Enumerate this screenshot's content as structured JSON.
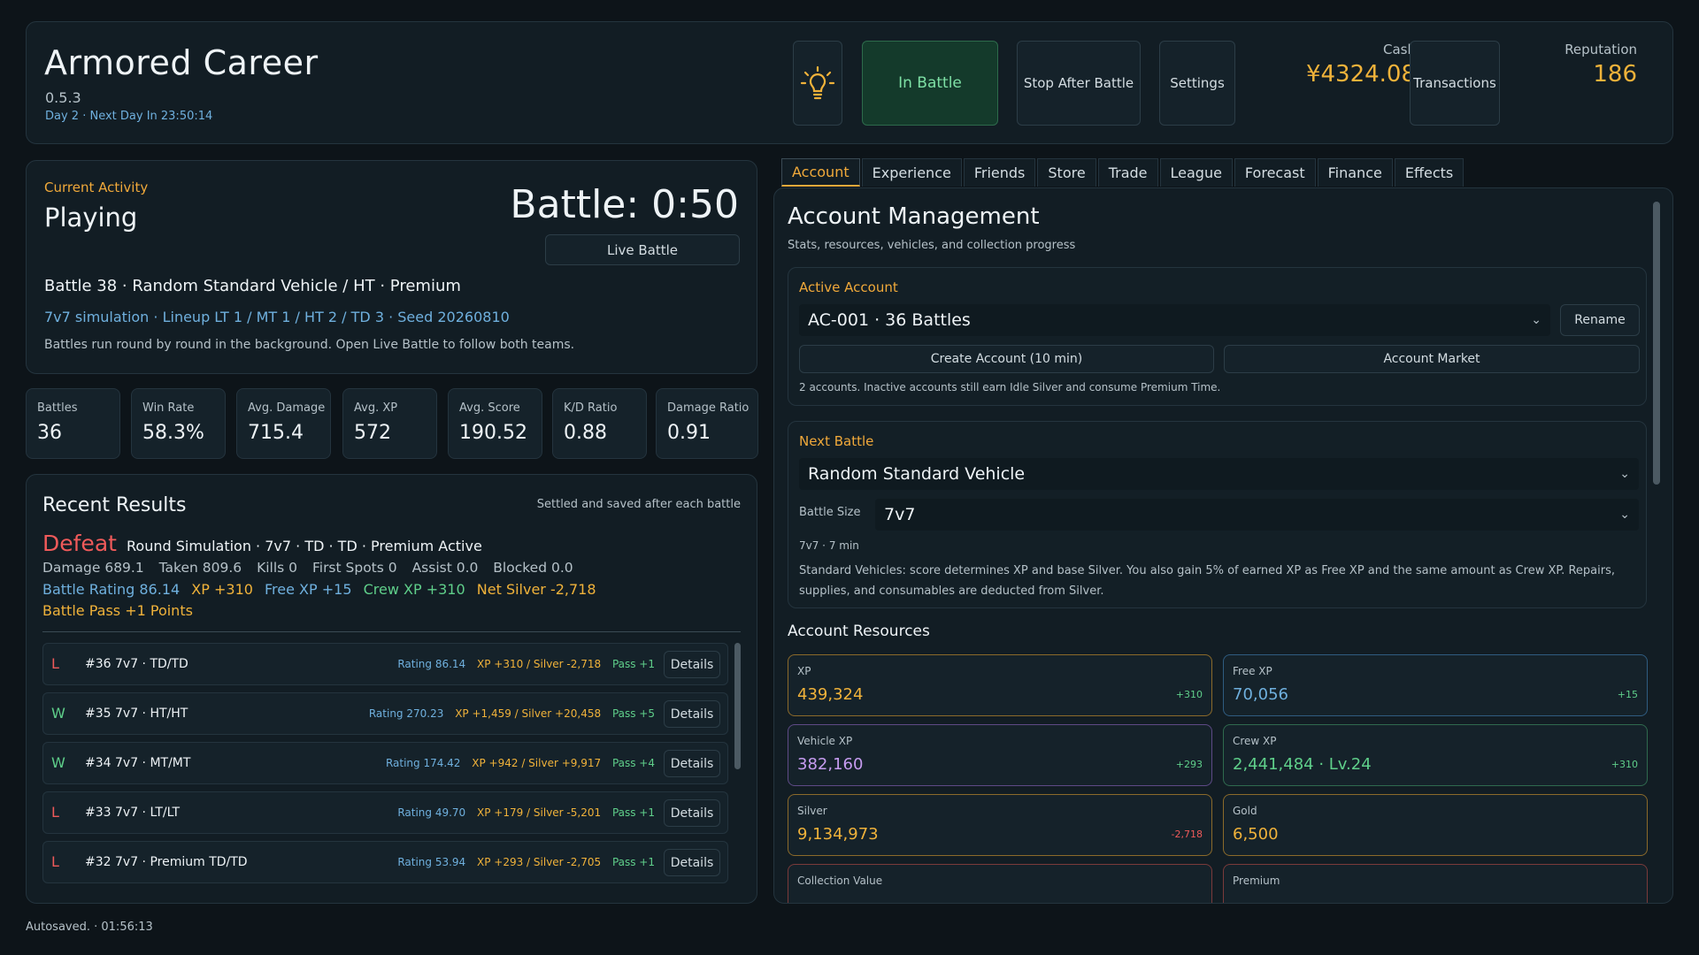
{
  "header": {
    "title": "Armored Career",
    "version": "0.5.3",
    "day_text": "Day 2 · Next Day In 23:50:14",
    "in_battle_label": "In Battle",
    "stop_label": "Stop After Battle",
    "settings_label": "Settings",
    "cash_label": "Cash",
    "cash_value": "¥4324.08",
    "transactions_label": "Transactions",
    "reputation_label": "Reputation",
    "reputation_value": "186"
  },
  "activity": {
    "label": "Current Activity",
    "status": "Playing",
    "timer": "Battle: 0:50",
    "live_label": "Live Battle",
    "battle_info": "Battle 38 · Random Standard Vehicle / HT · Premium",
    "sim_info": "7v7 simulation · Lineup LT 1 / MT 1 / HT 2 / TD 3 · Seed 20260810",
    "note": "Battles run round by round in the background. Open Live Battle to follow both teams."
  },
  "stats": [
    {
      "label": "Battles",
      "value": "36"
    },
    {
      "label": "Win Rate",
      "value": "58.3%"
    },
    {
      "label": "Avg. Damage",
      "value": "715.4"
    },
    {
      "label": "Avg. XP",
      "value": "572"
    },
    {
      "label": "Avg. Score",
      "value": "190.52"
    },
    {
      "label": "K/D Ratio",
      "value": "0.88"
    },
    {
      "label": "Damage Ratio",
      "value": "0.91"
    }
  ],
  "recent": {
    "title": "Recent Results",
    "note": "Settled and saved after each battle",
    "last": {
      "outcome": "Defeat",
      "desc": "Round Simulation · 7v7 · TD · TD · Premium Active",
      "damage": "Damage 689.1",
      "taken": "Taken 809.6",
      "kills": "Kills 0",
      "first_spots": "First Spots 0",
      "assist": "Assist 0.0",
      "blocked": "Blocked 0.0",
      "rating": "Battle Rating 86.14",
      "xp": "XP +310",
      "free_xp": "Free XP +15",
      "crew_xp": "Crew XP +310",
      "net_silver": "Net Silver -2,718",
      "pass": "Battle Pass +1 Points"
    },
    "details_label": "Details",
    "rows": [
      {
        "wl": "L",
        "title": "#36  7v7 · TD/TD",
        "rating": "Rating 86.14",
        "xp": "XP +310 / Silver -2,718",
        "pass": "Pass +1"
      },
      {
        "wl": "W",
        "title": "#35  7v7 · HT/HT",
        "rating": "Rating 270.23",
        "xp": "XP +1,459 / Silver +20,458",
        "pass": "Pass +5"
      },
      {
        "wl": "W",
        "title": "#34  7v7 · MT/MT",
        "rating": "Rating 174.42",
        "xp": "XP +942 / Silver +9,917",
        "pass": "Pass +4"
      },
      {
        "wl": "L",
        "title": "#33  7v7 · LT/LT",
        "rating": "Rating 49.70",
        "xp": "XP +179 / Silver -5,201",
        "pass": "Pass +1"
      },
      {
        "wl": "L",
        "title": "#32  7v7 · Premium TD/TD",
        "rating": "Rating 53.94",
        "xp": "XP +293 / Silver -2,705",
        "pass": "Pass +1"
      }
    ]
  },
  "autosave": "Autosaved.  ·  01:56:13",
  "tabs": [
    "Account",
    "Experience",
    "Friends",
    "Store",
    "Trade",
    "League",
    "Forecast",
    "Finance",
    "Effects"
  ],
  "account": {
    "title": "Account Management",
    "subtitle": "Stats, resources, vehicles, and collection progress",
    "active_label": "Active Account",
    "active_value": "AC-001 · 36 Battles",
    "rename_label": "Rename",
    "create_label": "Create Account (10 min)",
    "market_label": "Account Market",
    "note": "2 accounts. Inactive accounts still earn Idle Silver and consume Premium Time.",
    "next_label": "Next Battle",
    "next_value": "Random Standard Vehicle",
    "size_label": "Battle Size",
    "size_value": "7v7",
    "meta": "7v7 · 7 min",
    "desc": "Standard Vehicles: score determines XP and base Silver. You also gain 5% of earned XP as Free XP and the same amount as Crew XP. Repairs, supplies, and consumables are deducted from Silver.",
    "resources_title": "Account Resources",
    "resources": [
      {
        "label": "XP",
        "value": "439,324",
        "delta": "+310"
      },
      {
        "label": "Free XP",
        "value": "70,056",
        "delta": "+15"
      },
      {
        "label": "Vehicle XP",
        "value": "382,160",
        "delta": "+293"
      },
      {
        "label": "Crew XP",
        "value": "2,441,484 · Lv.24",
        "delta": "+310"
      },
      {
        "label": "Silver",
        "value": "9,134,973",
        "delta": "-2,718"
      },
      {
        "label": "Gold",
        "value": "6,500",
        "delta": ""
      },
      {
        "label": "Collection Value",
        "value": "",
        "delta": ""
      },
      {
        "label": "Premium",
        "value": "",
        "delta": ""
      }
    ]
  },
  "colors": {
    "accent": "#f0a93a",
    "gold": "#f0b23a",
    "blue": "#6fb0de",
    "green": "#5fcf8a",
    "red": "#ef5a5a",
    "violet": "#c69cf0"
  }
}
